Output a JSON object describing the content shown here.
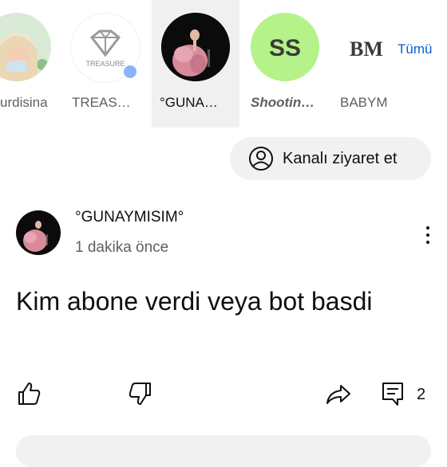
{
  "channels": [
    {
      "name": "urdisina",
      "selected": false
    },
    {
      "name": "TREAS…",
      "selected": false,
      "logo_text": "TREASURE",
      "has_new_dot": true
    },
    {
      "name": "°GUNA…",
      "selected": true
    },
    {
      "name": "Shootin…",
      "selected": false,
      "logo_text": "SS"
    },
    {
      "name": "BABYM",
      "selected": false,
      "logo_text": "BM"
    }
  ],
  "all_link": "Tümü",
  "visit_channel_button": "Kanalı ziyaret et",
  "post": {
    "author": "°GUNAYMISIM°",
    "time": "1 dakika önce",
    "text": "Kim abone verdi veya bot basdi",
    "comment_count": "2"
  },
  "icons": {
    "visit_channel": "account-circle-icon",
    "more": "more-vertical-icon",
    "like": "thumb-up-icon",
    "dislike": "thumb-down-icon",
    "share": "share-icon",
    "comments": "comment-icon"
  },
  "colors": {
    "accent_blue": "#065fd4",
    "ss_bg": "#b5f28a",
    "dot_blue": "#8ab4f8"
  }
}
